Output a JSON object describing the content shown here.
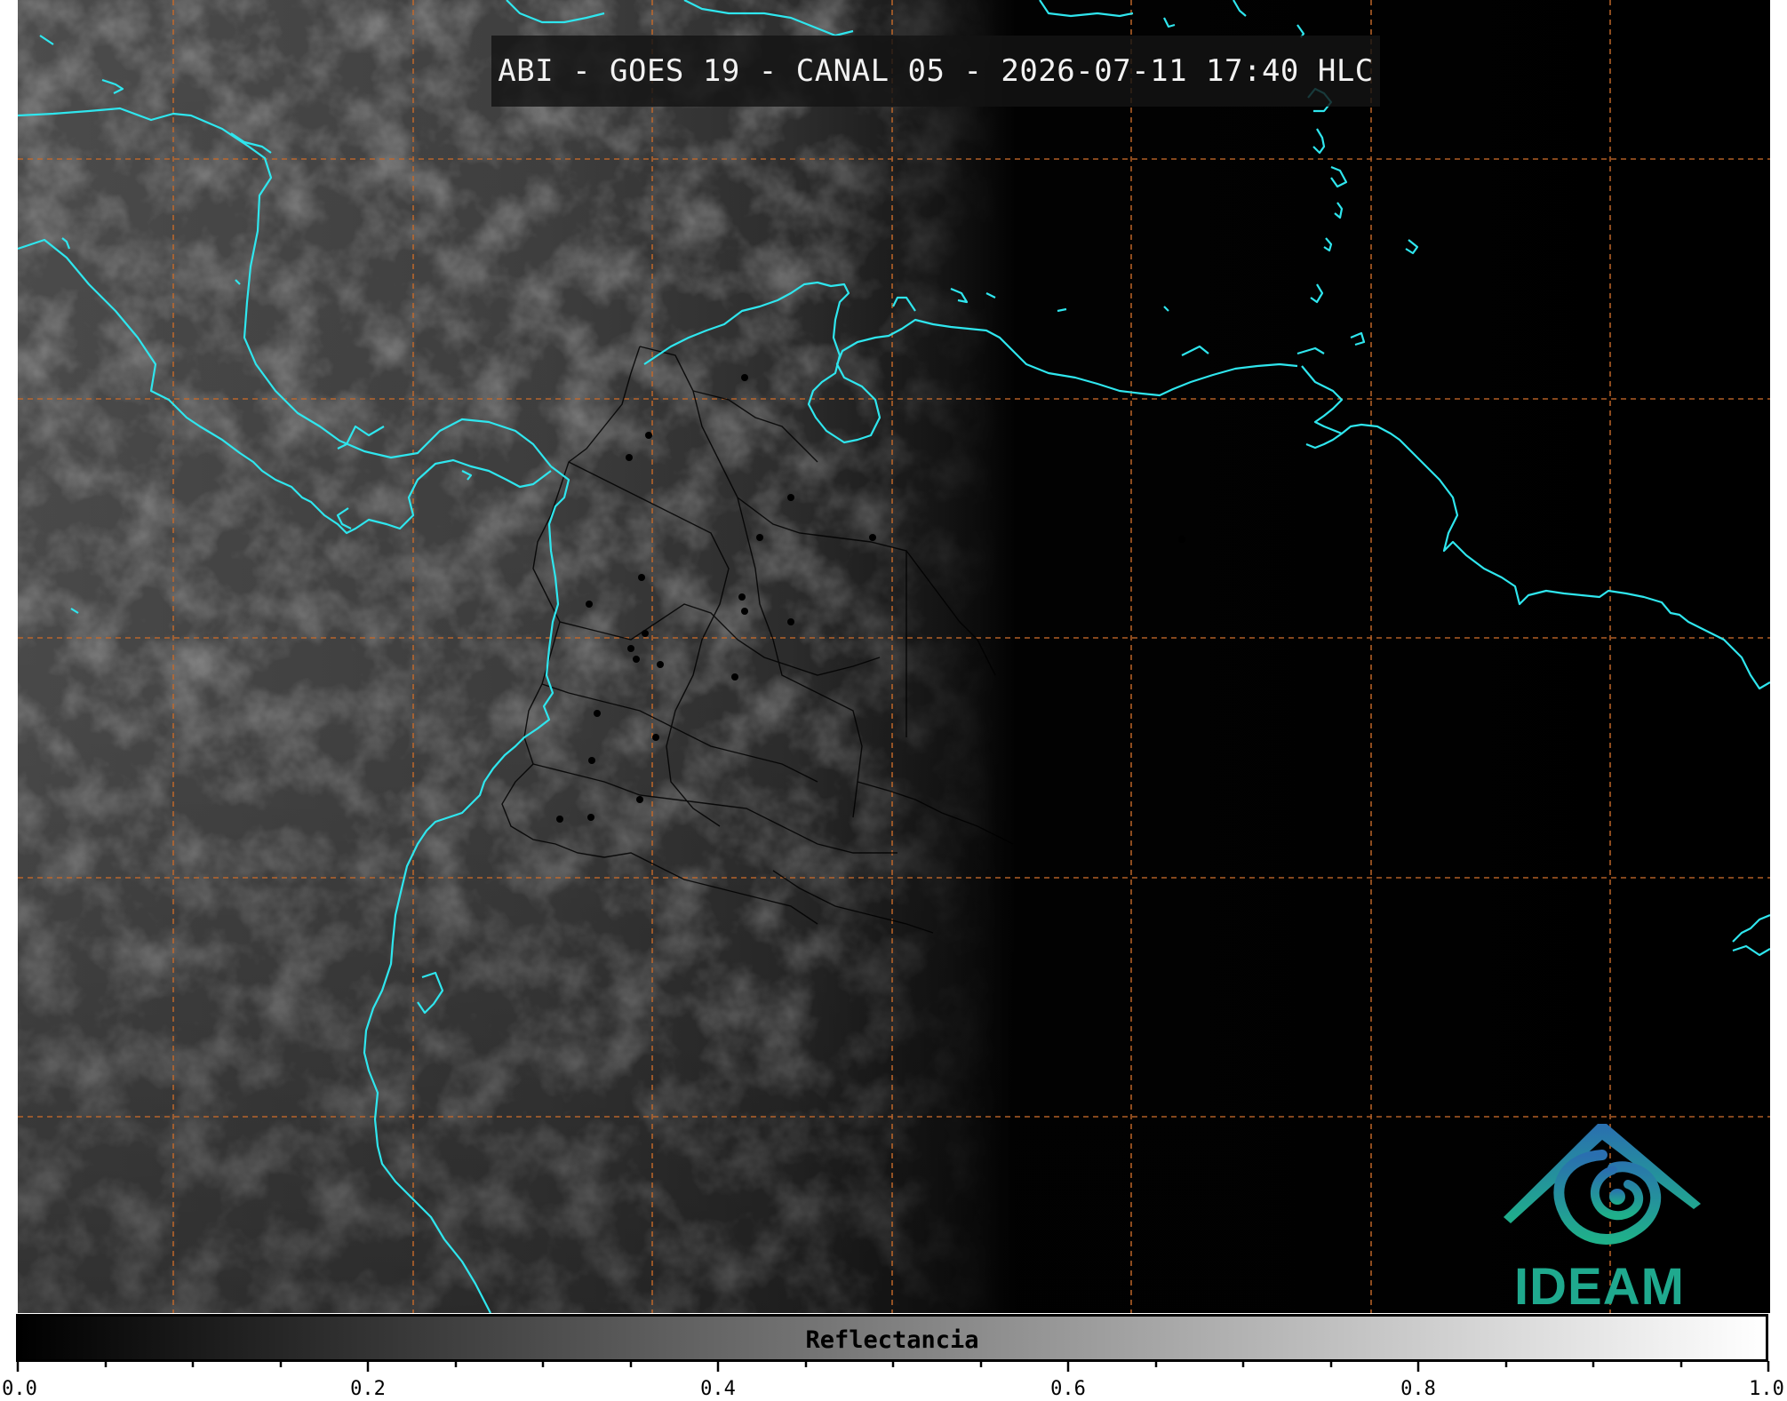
{
  "title": "ABI - GOES 19 - CANAL 05 - 2026-07-11 17:40 HLC",
  "colorbar": {
    "label": "Reflectancia",
    "min": 0.0,
    "max": 1.0,
    "tick_labels": [
      "0.0",
      "0.2",
      "0.4",
      "0.6",
      "0.8",
      "1.0"
    ]
  },
  "logo": {
    "text": "IDEAM"
  },
  "colors": {
    "coastline": "#2fe6ee",
    "gridline": "#c4692a",
    "borders": "#000000",
    "logo_green": "#1fa98e",
    "logo_blue": "#2a6fb0"
  }
}
